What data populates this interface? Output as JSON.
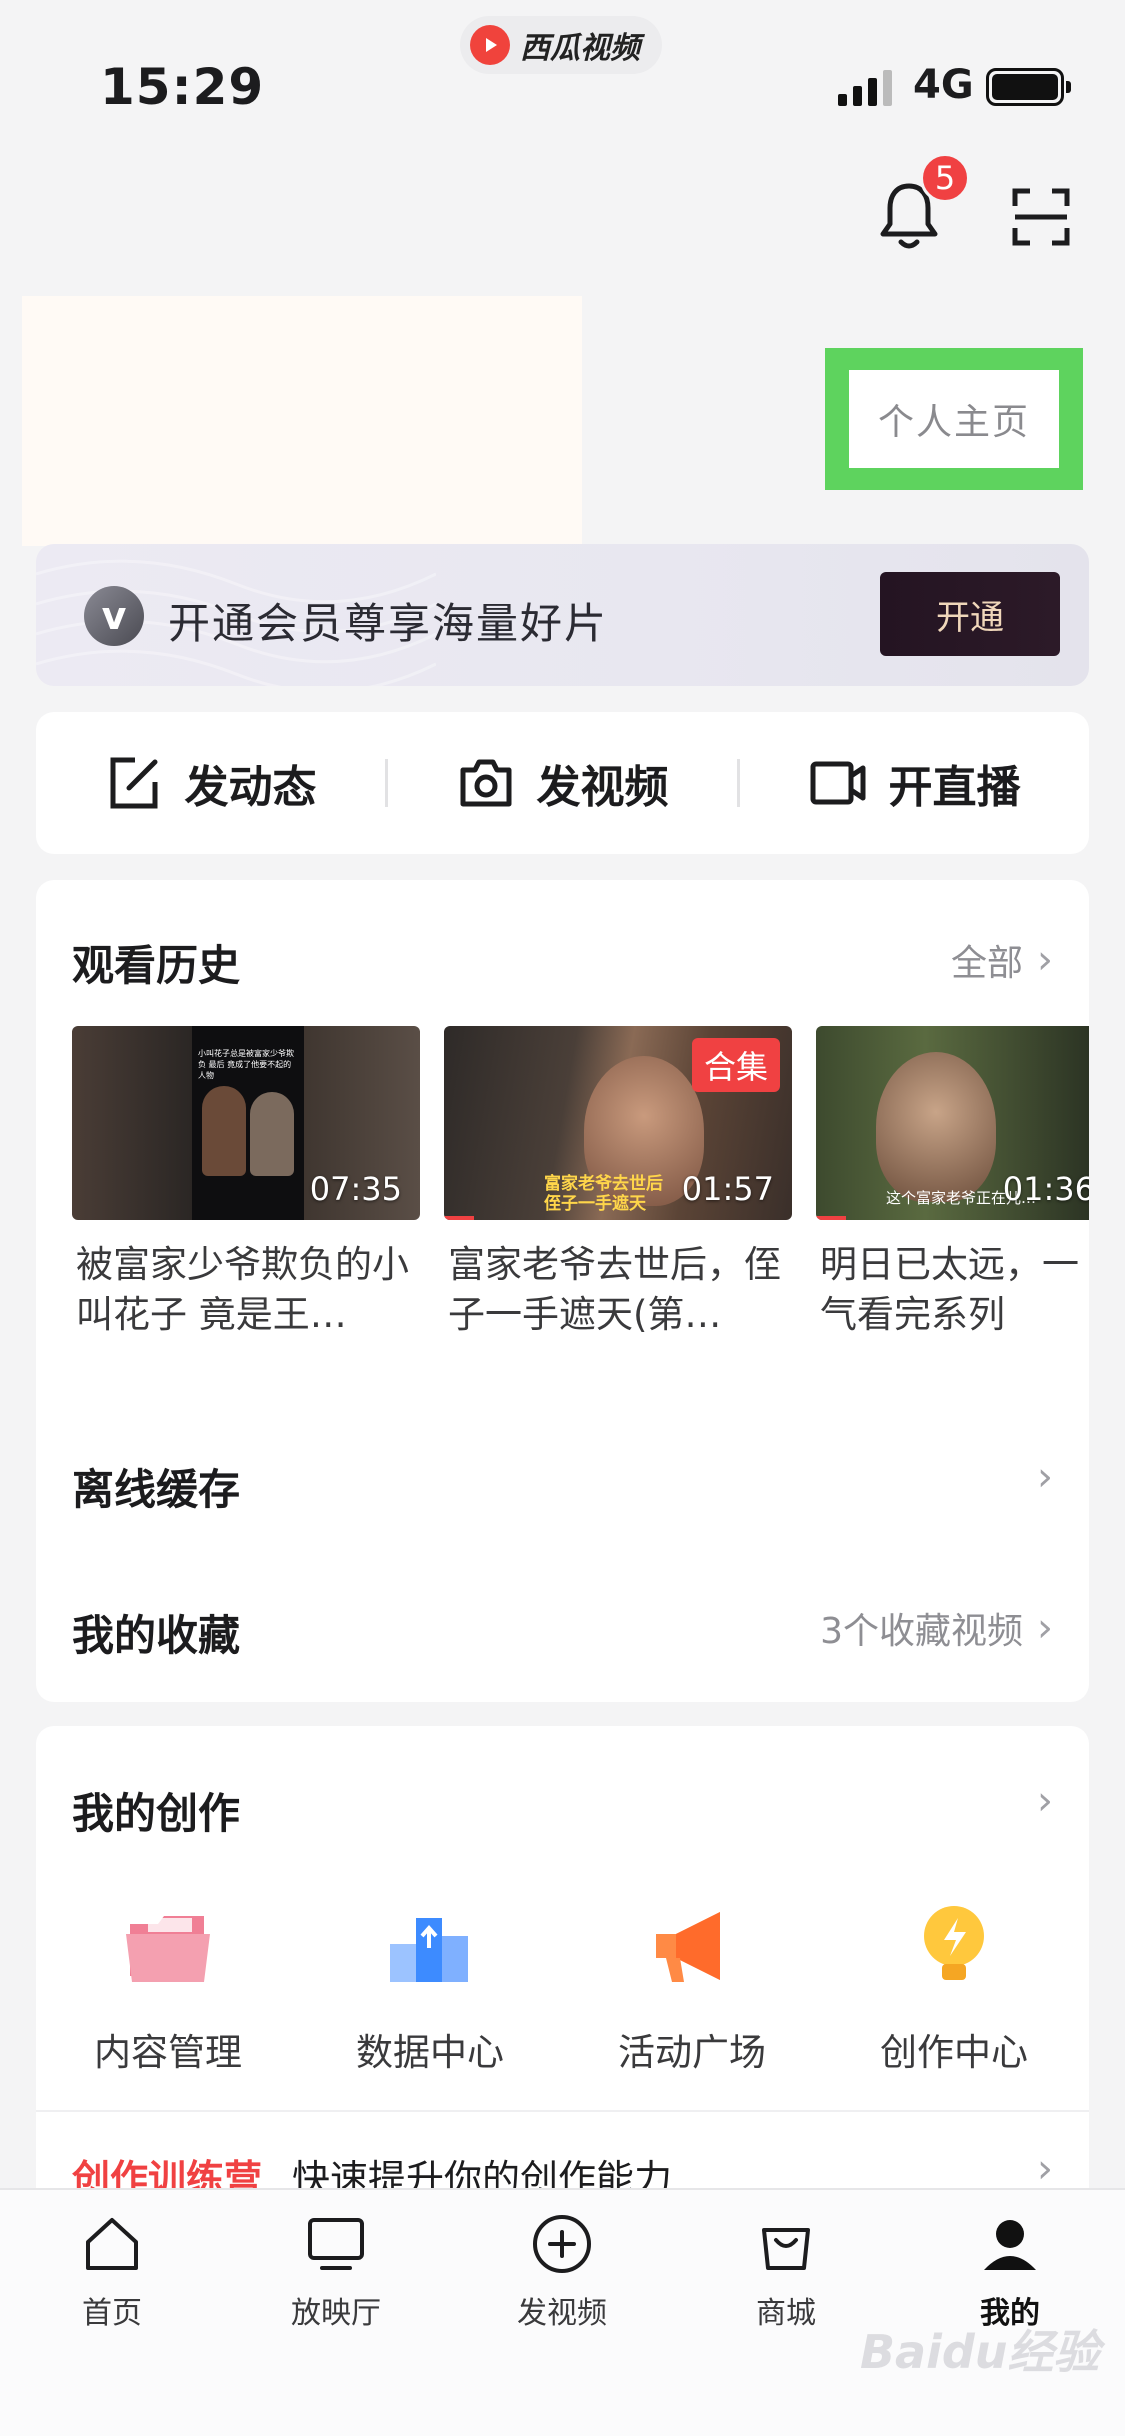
{
  "status_bar": {
    "time": "15:29",
    "app_name": "西瓜视频",
    "network": "4G"
  },
  "header": {
    "notification_count": "5"
  },
  "profile": {
    "homepage_label": "个人主页"
  },
  "vip": {
    "text": "开通会员尊享海量好片",
    "button": "开通",
    "logo": "v"
  },
  "quick_actions": [
    {
      "label": "发动态",
      "icon": "edit-icon"
    },
    {
      "label": "发视频",
      "icon": "camera-icon"
    },
    {
      "label": "开直播",
      "icon": "video-camera-icon"
    }
  ],
  "history": {
    "title": "观看历史",
    "more": "全部",
    "items": [
      {
        "duration": "07:35",
        "caption": "被富家少爷欺负的小叫花子 竟是王…",
        "thumb_text": "小叫花子总是被富家少爷欺负 最后 竟成了他要不起的人物"
      },
      {
        "duration": "01:57",
        "caption": "富家老爷去世后，侄子一手遮天(第…",
        "tag": "合集",
        "thumb_text": "富家老爷去世后 侄子一手遮天"
      },
      {
        "duration": "01:36",
        "caption": "明日已太远，一气看完系列",
        "thumb_text": "这个富家老爷正在儿…"
      }
    ]
  },
  "offline": {
    "title": "离线缓存"
  },
  "favorites": {
    "title": "我的收藏",
    "summary": "3个收藏视频"
  },
  "creation": {
    "title": "我的创作",
    "tools": [
      {
        "label": "内容管理",
        "icon": "folder-icon"
      },
      {
        "label": "数据中心",
        "icon": "chart-icon"
      },
      {
        "label": "活动广场",
        "icon": "megaphone-icon"
      },
      {
        "label": "创作中心",
        "icon": "bulb-icon"
      }
    ],
    "camp_tag": "创作训练营",
    "camp_text": "快速提升你的创作能力"
  },
  "tabs": [
    {
      "label": "首页",
      "icon": "home-icon"
    },
    {
      "label": "放映厅",
      "icon": "tv-icon"
    },
    {
      "label": "发视频",
      "icon": "plus-circle-icon"
    },
    {
      "label": "商城",
      "icon": "shopping-bag-icon"
    },
    {
      "label": "我的",
      "icon": "profile-icon",
      "active": true
    }
  ],
  "watermark": "Baidu经验",
  "colors": {
    "accent_red": "#f04142",
    "highlight_green": "#5ed35e",
    "vip_button": "#241422"
  }
}
